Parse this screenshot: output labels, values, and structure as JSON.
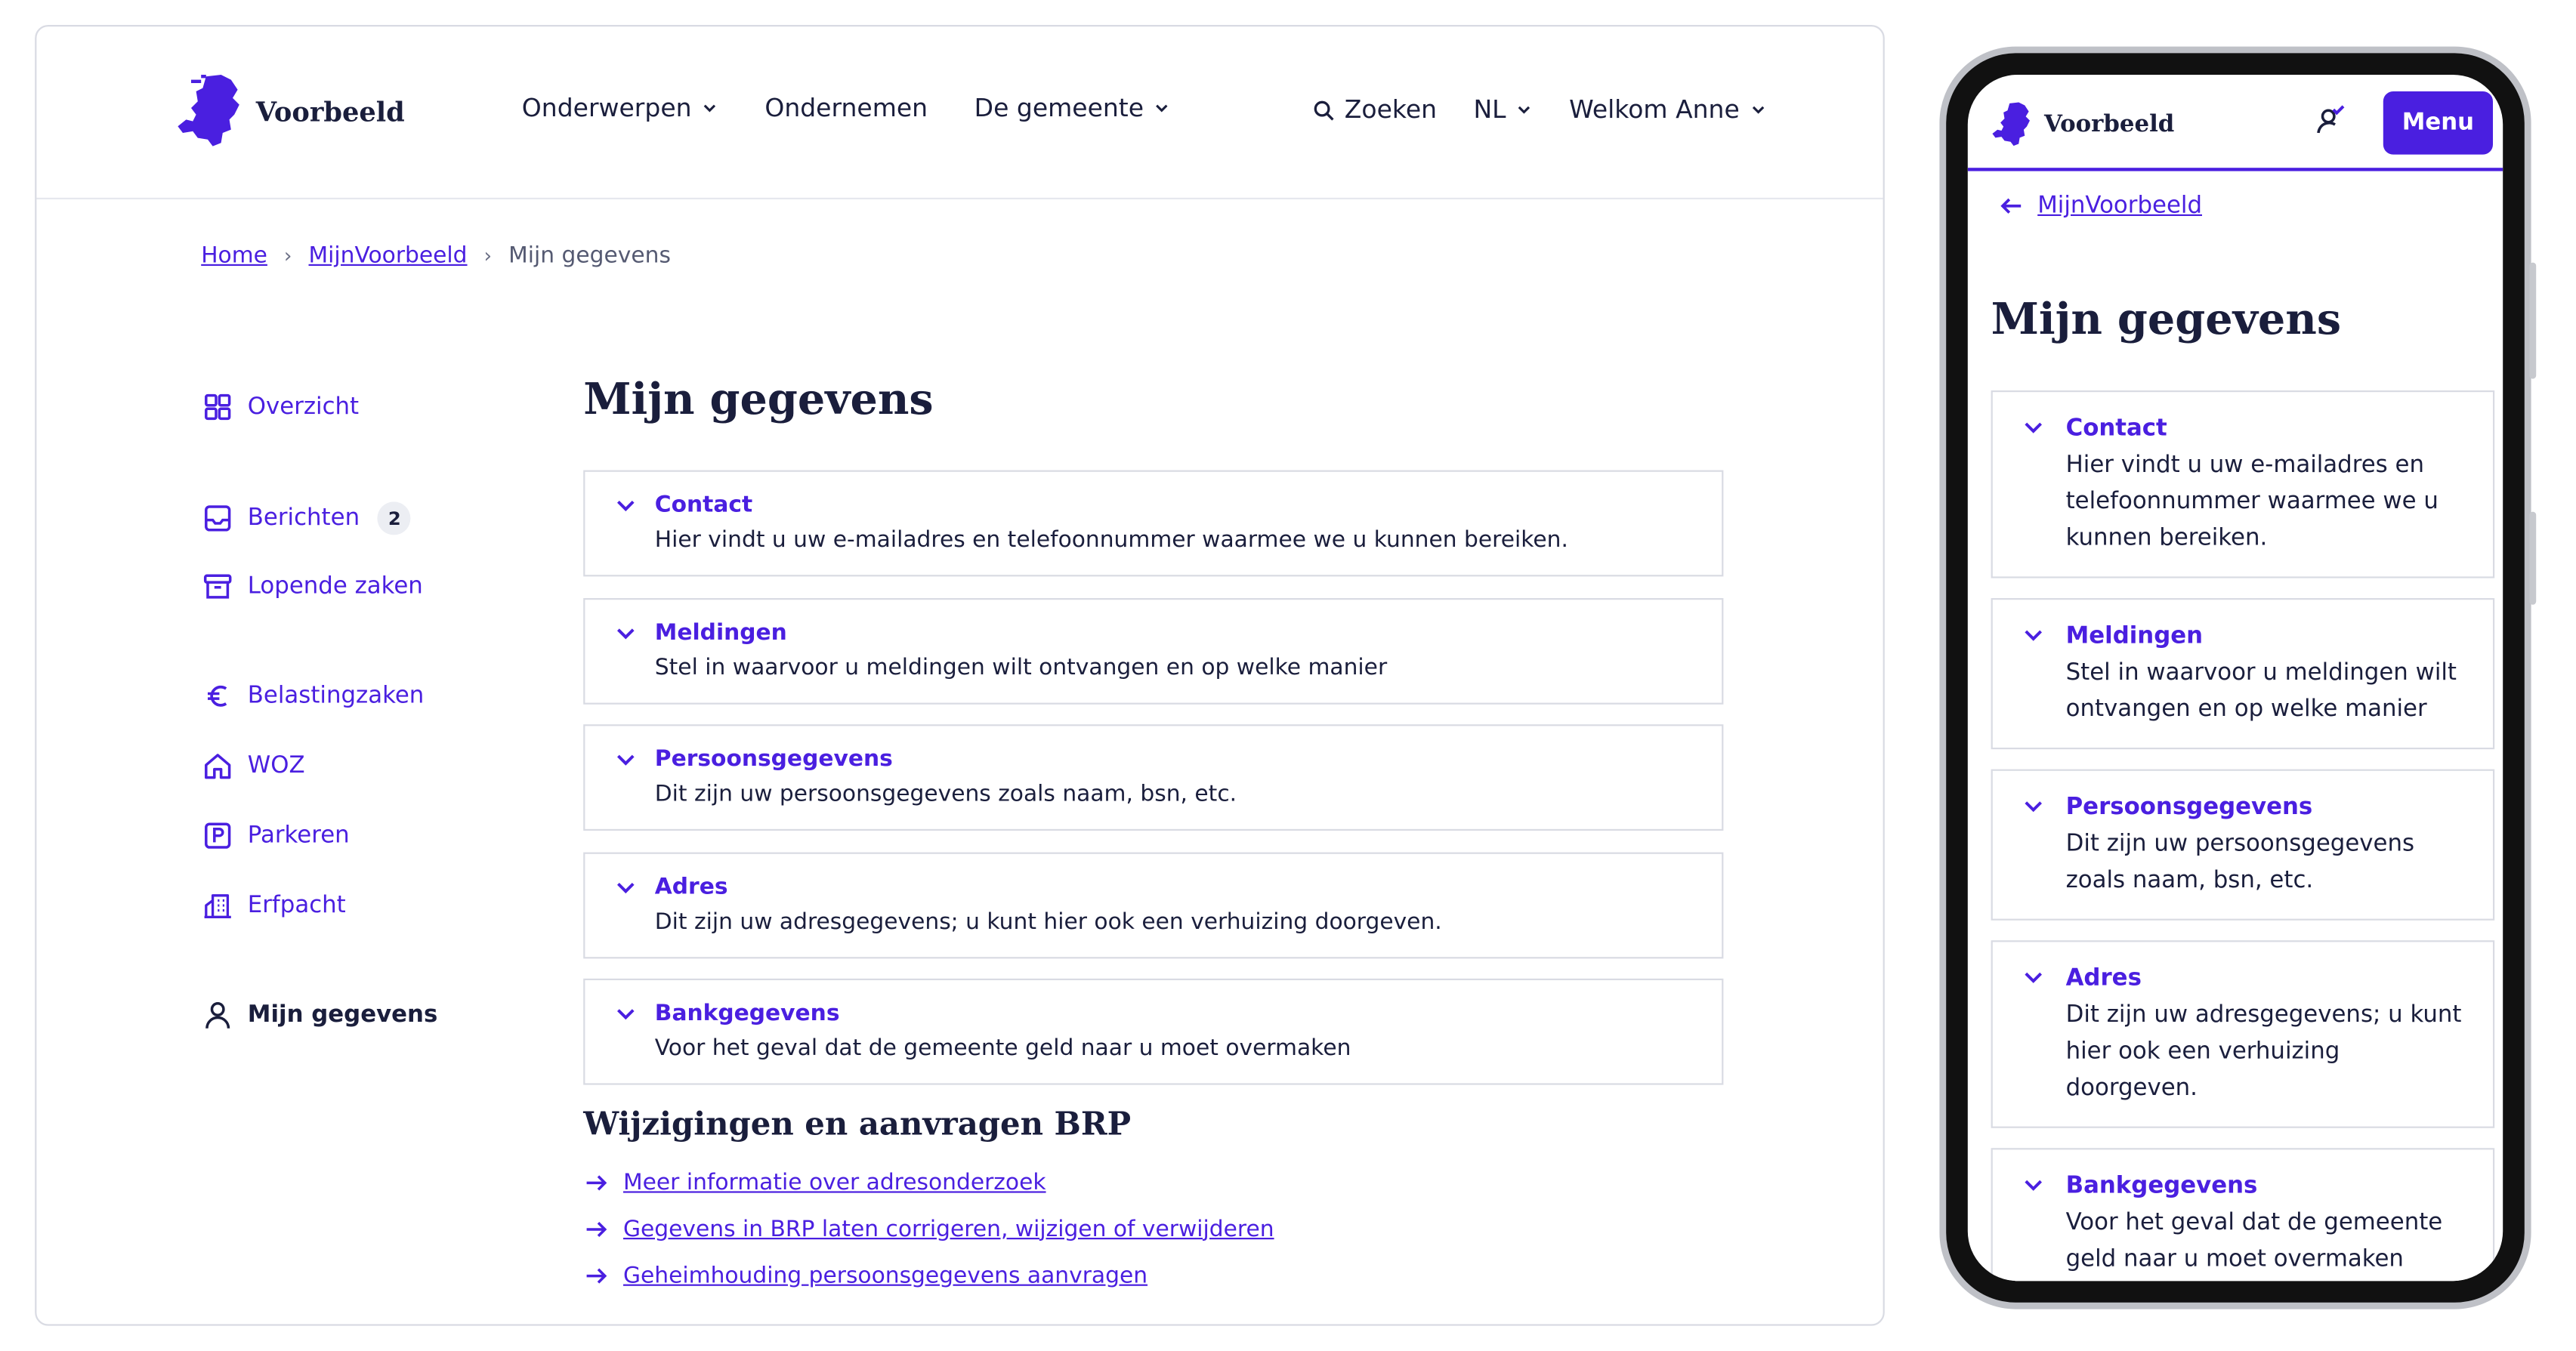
{
  "brand": {
    "name": "Voorbeeld",
    "accent_color": "#4a1fe0",
    "text_color": "#1a1e3c"
  },
  "desktop": {
    "nav": {
      "onderwerpen": "Onderwerpen",
      "ondernemen": "Ondernemen",
      "gemeente": "De gemeente",
      "zoeken": "Zoeken",
      "language": "NL",
      "welcome": "Welkom Anne"
    },
    "breadcrumb": {
      "home": "Home",
      "mijn": "MijnVoorbeeld",
      "current": "Mijn gegevens"
    },
    "sidebar": {
      "overzicht": "Overzicht",
      "berichten": "Berichten",
      "berichten_count": "2",
      "lopende": "Lopende zaken",
      "belasting": "Belastingzaken",
      "woz": "WOZ",
      "parkeren": "Parkeren",
      "erfpacht": "Erfpacht",
      "mijn_gegevens": "Mijn gegevens"
    },
    "page_title": "Mijn gegevens",
    "accordion": [
      {
        "title": "Contact",
        "description": "Hier vindt u uw e-mailadres en telefoonnummer waarmee we u kunnen bereiken."
      },
      {
        "title": "Meldingen",
        "description": "Stel in waarvoor u meldingen wilt ontvangen en op welke manier"
      },
      {
        "title": "Persoonsgegevens",
        "description": "Dit zijn uw persoonsgegevens zoals naam, bsn, etc."
      },
      {
        "title": "Adres",
        "description": "Dit zijn uw adresgegevens; u kunt hier ook een verhuizing doorgeven."
      },
      {
        "title": "Bankgegevens",
        "description": "Voor het geval dat de gemeente geld naar u moet overmaken"
      }
    ],
    "brp": {
      "title": "Wijzigingen en aanvragen BRP",
      "links": [
        "Meer informatie over adresonderzoek",
        "Gegevens in BRP laten corrigeren, wijzigen of verwijderen",
        "Geheimhouding persoonsgegevens aanvragen"
      ]
    }
  },
  "mobile": {
    "menu_label": "Menu",
    "back_link": "MijnVoorbeeld",
    "page_title": "Mijn gegevens",
    "accordion": [
      {
        "title": "Contact",
        "description": "Hier vindt u uw e-mailadres en telefoonnummer waarmee we u kunnen bereiken."
      },
      {
        "title": "Meldingen",
        "description": "Stel in waarvoor u meldingen wilt ontvangen en op welke manier"
      },
      {
        "title": "Persoonsgegevens",
        "description": "Dit zijn uw persoonsgegevens zoals naam, bsn, etc."
      },
      {
        "title": "Adres",
        "description": "Dit zijn uw adresgegevens; u kunt hier ook een verhuizing doorgeven."
      },
      {
        "title": "Bankgegevens",
        "description": "Voor het geval dat de gemeente geld naar u moet overmaken"
      }
    ]
  }
}
